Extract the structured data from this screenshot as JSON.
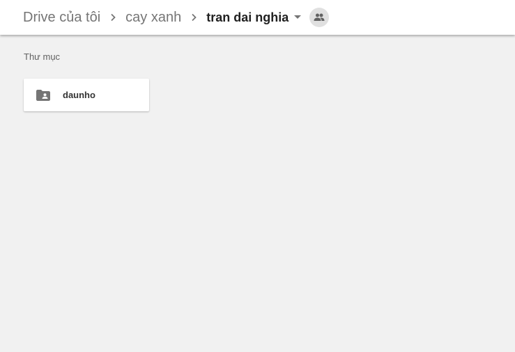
{
  "breadcrumb": {
    "items": [
      {
        "label": "Drive của tôi"
      },
      {
        "label": "cay xanh"
      },
      {
        "label": "tran dai nghia"
      }
    ],
    "separator_icon": "chevron-right-icon",
    "dropdown_icon": "caret-down-icon",
    "shared_icon": "people-icon"
  },
  "main": {
    "section_label": "Thư mục",
    "folders": [
      {
        "name": "daunho",
        "icon": "shared-folder-icon"
      }
    ]
  },
  "colors": {
    "background": "#f1f1f1",
    "header": "#ffffff",
    "icon_gray": "#757575",
    "shared_badge": "#e0e0e0"
  }
}
